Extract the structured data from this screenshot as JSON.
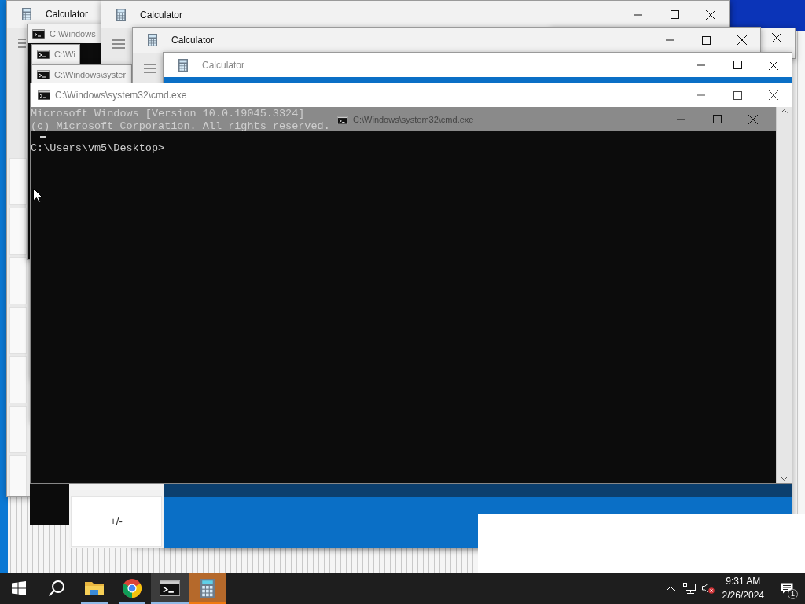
{
  "desktop_windows": [
    {
      "kind": "calculator",
      "title": "Calculator"
    },
    {
      "kind": "console",
      "title": "C:\\Windows"
    },
    {
      "kind": "calculator",
      "title": "Calculator"
    },
    {
      "kind": "calculator"
    },
    {
      "kind": "console",
      "title": "C:\\Wi"
    },
    {
      "kind": "console",
      "title": "C:\\Windows\\syster"
    },
    {
      "kind": "calculator",
      "title": "Calculator"
    },
    {
      "kind": "calculator",
      "title": "Calculator"
    }
  ],
  "calculator_key": "+/-",
  "console_window": {
    "title": "C:\\Windows\\system32\\cmd.exe",
    "ghost_title": "C:\\Windows\\system32\\cmd.exe",
    "lines": [
      "Microsoft Windows [Version 10.0.19045.3324]",
      "(c) Microsoft Corporation. All rights reserved."
    ],
    "prompt": "C:\\Users\\vm5\\Desktop>"
  },
  "taskbar": {
    "apps": [
      {
        "kind": "start",
        "running": false,
        "selected": false,
        "flashing": false
      },
      {
        "kind": "search",
        "running": false,
        "selected": false,
        "flashing": false
      },
      {
        "kind": "explorer",
        "running": true,
        "selected": false,
        "flashing": false
      },
      {
        "kind": "chrome",
        "running": true,
        "selected": false,
        "flashing": false
      },
      {
        "kind": "console",
        "running": true,
        "selected": true,
        "flashing": false
      },
      {
        "kind": "calculator",
        "running": true,
        "selected": false,
        "flashing": true
      }
    ],
    "volume_muted": true,
    "time": "9:31 AM",
    "date": "2/26/2024",
    "notification_count": "1"
  }
}
